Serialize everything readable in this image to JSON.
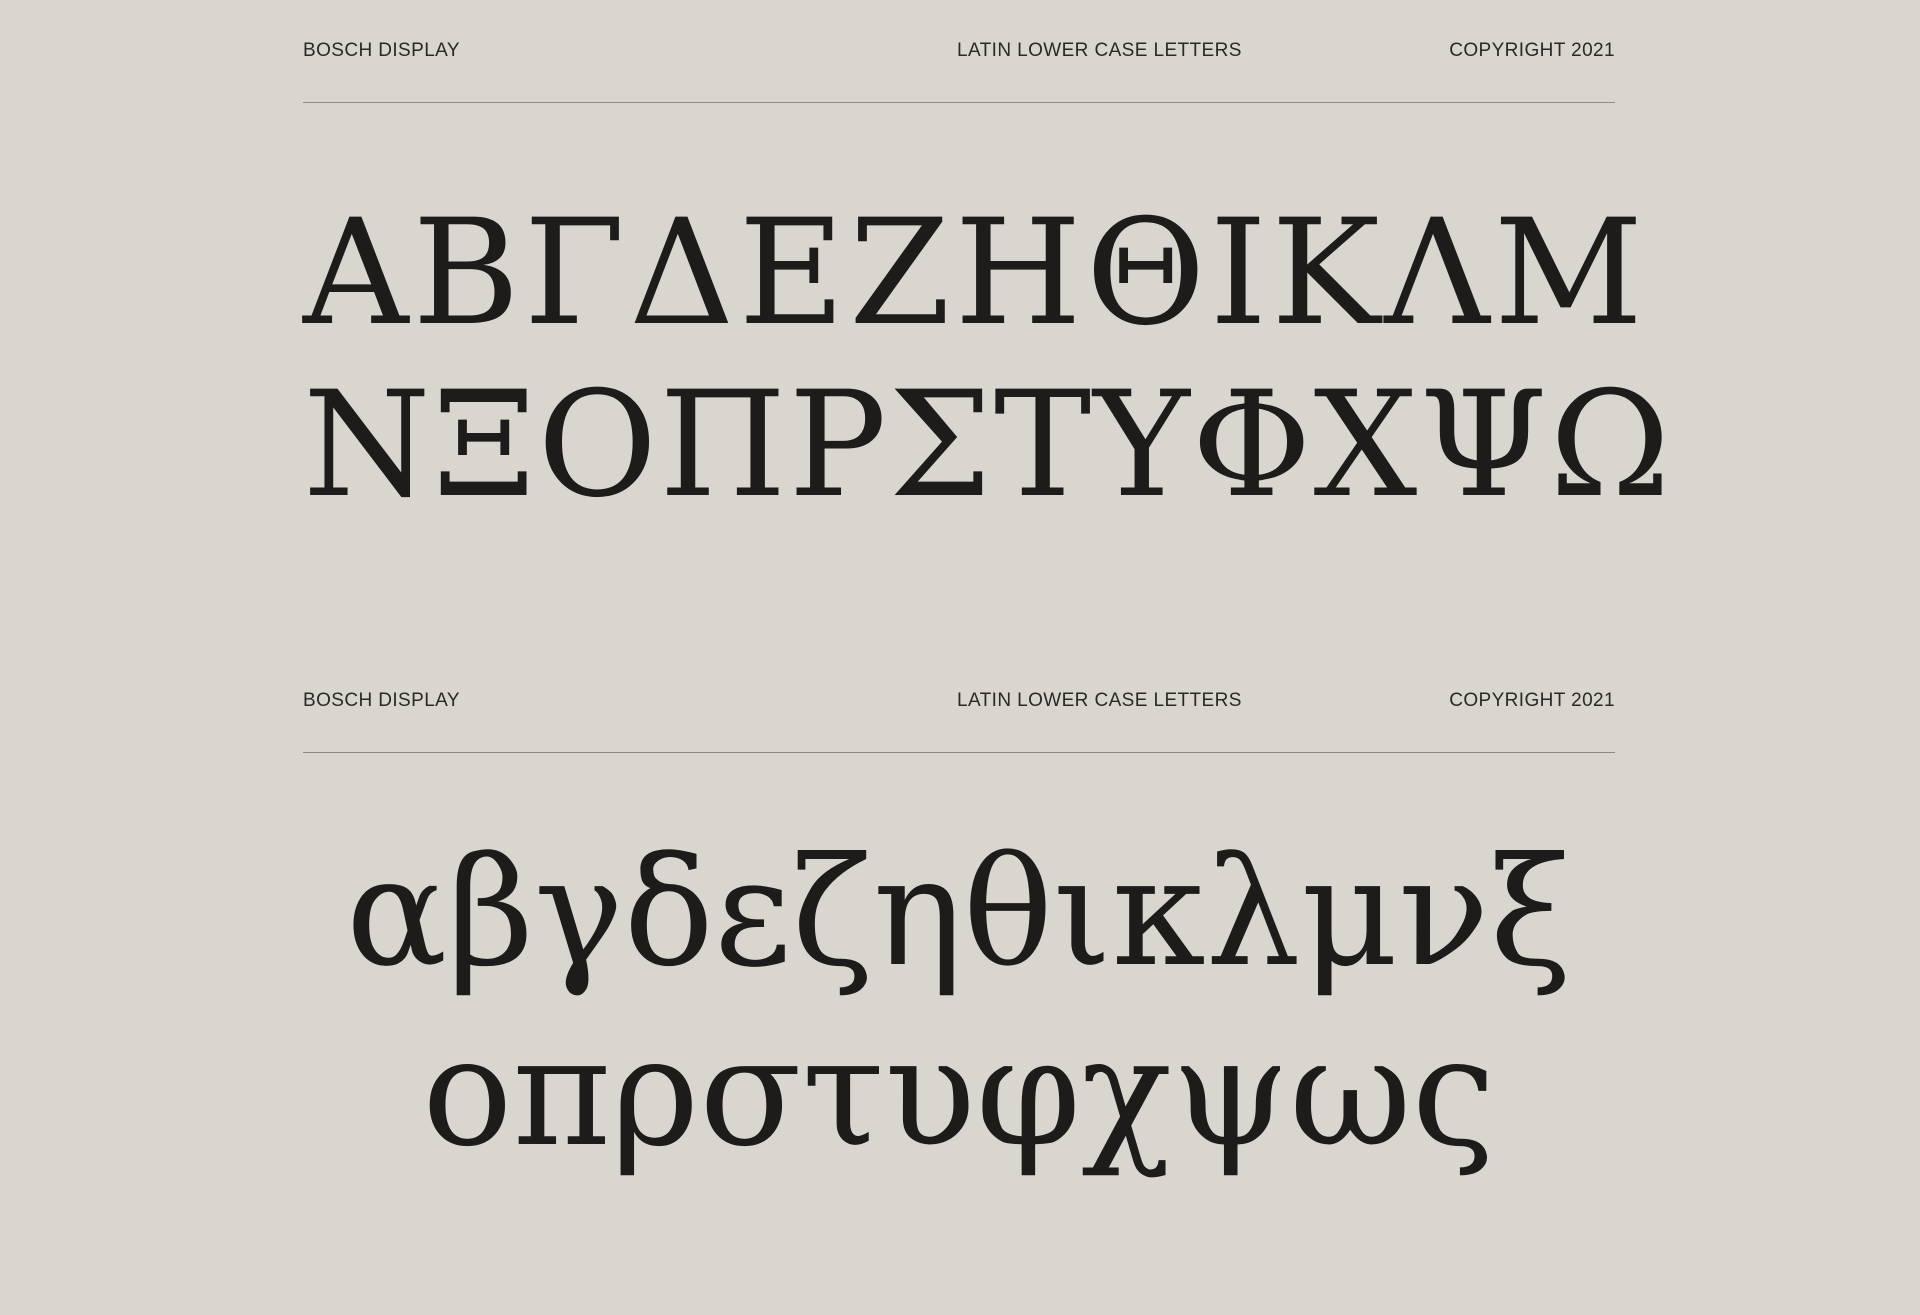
{
  "sections": [
    {
      "header": {
        "left": "BOSCH DISPLAY",
        "center": "LATIN LOWER CASE LETTERS",
        "right": "COPYRIGHT 2021"
      },
      "rows": [
        "ΑΒΓΔΕΖΗΘΙΚΛΜ",
        "ΝΞΟΠΡΣΤΥΦΧΨΩ"
      ]
    },
    {
      "header": {
        "left": "BOSCH DISPLAY",
        "center": "LATIN LOWER CASE LETTERS",
        "right": "COPYRIGHT 2021"
      },
      "rows": [
        "αβγδεζηθικλμνξ",
        "οπρστυφχψως"
      ]
    }
  ],
  "colors": {
    "background": "#d9d5cf",
    "ink": "#1d1c1a",
    "rule": "#8f8b86"
  }
}
